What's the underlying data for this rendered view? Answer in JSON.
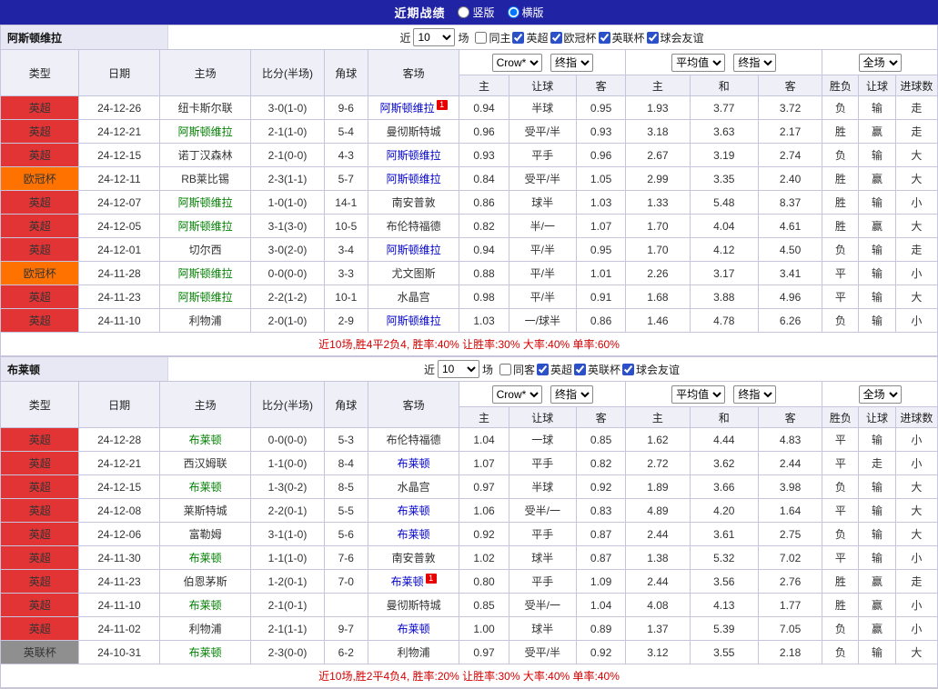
{
  "topbar": {
    "title": "近期战绩",
    "layout_options": [
      {
        "label": "竖版",
        "selected": false
      },
      {
        "label": "横版",
        "selected": true
      }
    ]
  },
  "columns": {
    "main": [
      "类型",
      "日期",
      "主场",
      "比分(半场)",
      "角球",
      "客场"
    ],
    "sub": [
      "主",
      "让球",
      "客",
      "主",
      "和",
      "客",
      "胜负",
      "让球",
      "进球数"
    ]
  },
  "colors": {
    "topbar_bg": "#2123a5",
    "league_red": "#e23434",
    "league_orange": "#ff7200",
    "league_gray": "#8f8f8f",
    "text_red": "#d40000",
    "text_blue": "#0000cc",
    "text_green": "#008000",
    "header_bg": "#efeff8",
    "team_home_green": "#008000",
    "team_away_blue": "#0000cc"
  },
  "sections": [
    {
      "team": "阿斯顿维拉",
      "filter": {
        "prefix": "近",
        "count": "10",
        "suffix": "场",
        "checkboxes": [
          {
            "label": "同主",
            "checked": false
          },
          {
            "label": "英超",
            "checked": true
          },
          {
            "label": "欧冠杯",
            "checked": true
          },
          {
            "label": "英联杯",
            "checked": true
          },
          {
            "label": "球会友谊",
            "checked": true
          }
        ]
      },
      "dropdowns": {
        "bookmaker": "Crow*",
        "ah_stage": "终指",
        "eu_source": "平均值",
        "eu_stage": "终指",
        "scope": "全场"
      },
      "rows": [
        {
          "lg": "英超",
          "lgc": "red",
          "date": "24-12-26",
          "home": "纽卡斯尔联",
          "homeHl": "",
          "homeCard": "",
          "score": "3-0(1-0)",
          "corner": "9-6",
          "away": "阿斯顿维拉",
          "awayHl": "blue",
          "awayCard": "1",
          "ah": [
            "0.94",
            "半球",
            "0.95"
          ],
          "eu": [
            "1.93",
            "3.77",
            "3.72"
          ],
          "res": [
            [
              "负",
              "blue"
            ],
            [
              "输",
              "blue"
            ],
            [
              "走",
              "green"
            ]
          ]
        },
        {
          "lg": "英超",
          "lgc": "red",
          "date": "24-12-21",
          "home": "阿斯顿维拉",
          "homeHl": "green",
          "homeCard": "",
          "score": "2-1(1-0)",
          "corner": "5-4",
          "away": "曼彻斯特城",
          "awayHl": "",
          "awayCard": "",
          "ah": [
            "0.96",
            "受平/半",
            "0.93"
          ],
          "eu": [
            "3.18",
            "3.63",
            "2.17"
          ],
          "res": [
            [
              "胜",
              "red"
            ],
            [
              "赢",
              "red"
            ],
            [
              "走",
              "green"
            ]
          ]
        },
        {
          "lg": "英超",
          "lgc": "red",
          "date": "24-12-15",
          "home": "诺丁汉森林",
          "homeHl": "",
          "homeCard": "",
          "score": "2-1(0-0)",
          "corner": "4-3",
          "away": "阿斯顿维拉",
          "awayHl": "blue",
          "awayCard": "",
          "ah": [
            "0.93",
            "平手",
            "0.96"
          ],
          "eu": [
            "2.67",
            "3.19",
            "2.74"
          ],
          "res": [
            [
              "负",
              "blue"
            ],
            [
              "输",
              "blue"
            ],
            [
              "大",
              "red"
            ]
          ]
        },
        {
          "lg": "欧冠杯",
          "lgc": "orange",
          "date": "24-12-11",
          "home": "RB莱比锡",
          "homeHl": "",
          "homeCard": "",
          "score": "2-3(1-1)",
          "corner": "5-7",
          "away": "阿斯顿维拉",
          "awayHl": "blue",
          "awayCard": "",
          "ah": [
            "0.84",
            "受平/半",
            "1.05"
          ],
          "eu": [
            "2.99",
            "3.35",
            "2.40"
          ],
          "res": [
            [
              "胜",
              "red"
            ],
            [
              "赢",
              "red"
            ],
            [
              "大",
              "red"
            ]
          ]
        },
        {
          "lg": "英超",
          "lgc": "red",
          "date": "24-12-07",
          "home": "阿斯顿维拉",
          "homeHl": "green",
          "homeCard": "",
          "score": "1-0(1-0)",
          "corner": "14-1",
          "away": "南安普敦",
          "awayHl": "",
          "awayCard": "",
          "ah": [
            "0.86",
            "球半",
            "1.03"
          ],
          "eu": [
            "1.33",
            "5.48",
            "8.37"
          ],
          "res": [
            [
              "胜",
              "red"
            ],
            [
              "输",
              "blue"
            ],
            [
              "小",
              "blue"
            ]
          ]
        },
        {
          "lg": "英超",
          "lgc": "red",
          "date": "24-12-05",
          "home": "阿斯顿维拉",
          "homeHl": "green",
          "homeCard": "",
          "score": "3-1(3-0)",
          "corner": "10-5",
          "away": "布伦特福德",
          "awayHl": "",
          "awayCard": "",
          "ah": [
            "0.82",
            "半/一",
            "1.07"
          ],
          "eu": [
            "1.70",
            "4.04",
            "4.61"
          ],
          "res": [
            [
              "胜",
              "red"
            ],
            [
              "赢",
              "red"
            ],
            [
              "大",
              "red"
            ]
          ]
        },
        {
          "lg": "英超",
          "lgc": "red",
          "date": "24-12-01",
          "home": "切尔西",
          "homeHl": "",
          "homeCard": "",
          "score": "3-0(2-0)",
          "corner": "3-4",
          "away": "阿斯顿维拉",
          "awayHl": "blue",
          "awayCard": "",
          "ah": [
            "0.94",
            "平/半",
            "0.95"
          ],
          "eu": [
            "1.70",
            "4.12",
            "4.50"
          ],
          "res": [
            [
              "负",
              "blue"
            ],
            [
              "输",
              "blue"
            ],
            [
              "走",
              "green"
            ]
          ]
        },
        {
          "lg": "欧冠杯",
          "lgc": "orange",
          "date": "24-11-28",
          "home": "阿斯顿维拉",
          "homeHl": "green",
          "homeCard": "",
          "score": "0-0(0-0)",
          "corner": "3-3",
          "away": "尤文图斯",
          "awayHl": "",
          "awayCard": "",
          "ah": [
            "0.88",
            "平/半",
            "1.01"
          ],
          "eu": [
            "2.26",
            "3.17",
            "3.41"
          ],
          "res": [
            [
              "平",
              "green"
            ],
            [
              "输",
              "blue"
            ],
            [
              "小",
              "blue"
            ]
          ]
        },
        {
          "lg": "英超",
          "lgc": "red",
          "date": "24-11-23",
          "home": "阿斯顿维拉",
          "homeHl": "green",
          "homeCard": "",
          "score": "2-2(1-2)",
          "corner": "10-1",
          "away": "水晶宫",
          "awayHl": "",
          "awayCard": "",
          "ah": [
            "0.98",
            "平/半",
            "0.91"
          ],
          "eu": [
            "1.68",
            "3.88",
            "4.96"
          ],
          "res": [
            [
              "平",
              "green"
            ],
            [
              "输",
              "blue"
            ],
            [
              "大",
              "red"
            ]
          ]
        },
        {
          "lg": "英超",
          "lgc": "red",
          "date": "24-11-10",
          "home": "利物浦",
          "homeHl": "",
          "homeCard": "",
          "score": "2-0(1-0)",
          "corner": "2-9",
          "away": "阿斯顿维拉",
          "awayHl": "blue",
          "awayCard": "",
          "ah": [
            "1.03",
            "一/球半",
            "0.86"
          ],
          "eu": [
            "1.46",
            "4.78",
            "6.26"
          ],
          "res": [
            [
              "负",
              "blue"
            ],
            [
              "输",
              "blue"
            ],
            [
              "小",
              "blue"
            ]
          ]
        }
      ],
      "summary": "近10场,胜4平2负4, 胜率:40% 让胜率:30% 大率:40% 单率:60%"
    },
    {
      "team": "布莱顿",
      "filter": {
        "prefix": "近",
        "count": "10",
        "suffix": "场",
        "checkboxes": [
          {
            "label": "同客",
            "checked": false
          },
          {
            "label": "英超",
            "checked": true
          },
          {
            "label": "英联杯",
            "checked": true
          },
          {
            "label": "球会友谊",
            "checked": true
          }
        ]
      },
      "dropdowns": {
        "bookmaker": "Crow*",
        "ah_stage": "终指",
        "eu_source": "平均值",
        "eu_stage": "终指",
        "scope": "全场"
      },
      "rows": [
        {
          "lg": "英超",
          "lgc": "red",
          "date": "24-12-28",
          "home": "布莱顿",
          "homeHl": "green",
          "homeCard": "",
          "score": "0-0(0-0)",
          "corner": "5-3",
          "away": "布伦特福德",
          "awayHl": "",
          "awayCard": "",
          "ah": [
            "1.04",
            "一球",
            "0.85"
          ],
          "eu": [
            "1.62",
            "4.44",
            "4.83"
          ],
          "res": [
            [
              "平",
              "green"
            ],
            [
              "输",
              "blue"
            ],
            [
              "小",
              "blue"
            ]
          ]
        },
        {
          "lg": "英超",
          "lgc": "red",
          "date": "24-12-21",
          "home": "西汉姆联",
          "homeHl": "",
          "homeCard": "",
          "score": "1-1(0-0)",
          "corner": "8-4",
          "away": "布莱顿",
          "awayHl": "blue",
          "awayCard": "",
          "ah": [
            "1.07",
            "平手",
            "0.82"
          ],
          "eu": [
            "2.72",
            "3.62",
            "2.44"
          ],
          "res": [
            [
              "平",
              "green"
            ],
            [
              "走",
              "green"
            ],
            [
              "小",
              "blue"
            ]
          ]
        },
        {
          "lg": "英超",
          "lgc": "red",
          "date": "24-12-15",
          "home": "布莱顿",
          "homeHl": "green",
          "homeCard": "",
          "score": "1-3(0-2)",
          "corner": "8-5",
          "away": "水晶宫",
          "awayHl": "",
          "awayCard": "",
          "ah": [
            "0.97",
            "半球",
            "0.92"
          ],
          "eu": [
            "1.89",
            "3.66",
            "3.98"
          ],
          "res": [
            [
              "负",
              "blue"
            ],
            [
              "输",
              "blue"
            ],
            [
              "大",
              "red"
            ]
          ]
        },
        {
          "lg": "英超",
          "lgc": "red",
          "date": "24-12-08",
          "home": "莱斯特城",
          "homeHl": "",
          "homeCard": "",
          "score": "2-2(0-1)",
          "corner": "5-5",
          "away": "布莱顿",
          "awayHl": "blue",
          "awayCard": "",
          "ah": [
            "1.06",
            "受半/一",
            "0.83"
          ],
          "eu": [
            "4.89",
            "4.20",
            "1.64"
          ],
          "res": [
            [
              "平",
              "green"
            ],
            [
              "输",
              "blue"
            ],
            [
              "大",
              "red"
            ]
          ]
        },
        {
          "lg": "英超",
          "lgc": "red",
          "date": "24-12-06",
          "home": "富勒姆",
          "homeHl": "",
          "homeCard": "",
          "score": "3-1(1-0)",
          "corner": "5-6",
          "away": "布莱顿",
          "awayHl": "blue",
          "awayCard": "",
          "ah": [
            "0.92",
            "平手",
            "0.87"
          ],
          "eu": [
            "2.44",
            "3.61",
            "2.75"
          ],
          "res": [
            [
              "负",
              "blue"
            ],
            [
              "输",
              "blue"
            ],
            [
              "大",
              "red"
            ]
          ]
        },
        {
          "lg": "英超",
          "lgc": "red",
          "date": "24-11-30",
          "home": "布莱顿",
          "homeHl": "green",
          "homeCard": "",
          "score": "1-1(1-0)",
          "corner": "7-6",
          "away": "南安普敦",
          "awayHl": "",
          "awayCard": "",
          "ah": [
            "1.02",
            "球半",
            "0.87"
          ],
          "eu": [
            "1.38",
            "5.32",
            "7.02"
          ],
          "res": [
            [
              "平",
              "green"
            ],
            [
              "输",
              "blue"
            ],
            [
              "小",
              "blue"
            ]
          ]
        },
        {
          "lg": "英超",
          "lgc": "red",
          "date": "24-11-23",
          "home": "伯恩茅斯",
          "homeHl": "",
          "homeCard": "",
          "score": "1-2(0-1)",
          "corner": "7-0",
          "away": "布莱顿",
          "awayHl": "blue",
          "awayCard": "1",
          "ah": [
            "0.80",
            "平手",
            "1.09"
          ],
          "eu": [
            "2.44",
            "3.56",
            "2.76"
          ],
          "res": [
            [
              "胜",
              "red"
            ],
            [
              "赢",
              "red"
            ],
            [
              "走",
              "green"
            ]
          ]
        },
        {
          "lg": "英超",
          "lgc": "red",
          "date": "24-11-10",
          "home": "布莱顿",
          "homeHl": "green",
          "homeCard": "",
          "score": "2-1(0-1)",
          "corner": "",
          "away": "曼彻斯特城",
          "awayHl": "",
          "awayCard": "",
          "ah": [
            "0.85",
            "受半/一",
            "1.04"
          ],
          "eu": [
            "4.08",
            "4.13",
            "1.77"
          ],
          "res": [
            [
              "胜",
              "red"
            ],
            [
              "赢",
              "red"
            ],
            [
              "小",
              "blue"
            ]
          ]
        },
        {
          "lg": "英超",
          "lgc": "red",
          "date": "24-11-02",
          "home": "利物浦",
          "homeHl": "",
          "homeCard": "",
          "score": "2-1(1-1)",
          "corner": "9-7",
          "away": "布莱顿",
          "awayHl": "blue",
          "awayCard": "",
          "ah": [
            "1.00",
            "球半",
            "0.89"
          ],
          "eu": [
            "1.37",
            "5.39",
            "7.05"
          ],
          "res": [
            [
              "负",
              "blue"
            ],
            [
              "赢",
              "red"
            ],
            [
              "小",
              "blue"
            ]
          ]
        },
        {
          "lg": "英联杯",
          "lgc": "gray",
          "date": "24-10-31",
          "home": "布莱顿",
          "homeHl": "green",
          "homeCard": "",
          "score": "2-3(0-0)",
          "corner": "6-2",
          "away": "利物浦",
          "awayHl": "",
          "awayCard": "",
          "ah": [
            "0.97",
            "受平/半",
            "0.92"
          ],
          "eu": [
            "3.12",
            "3.55",
            "2.18"
          ],
          "res": [
            [
              "负",
              "blue"
            ],
            [
              "输",
              "blue"
            ],
            [
              "大",
              "red"
            ]
          ]
        }
      ],
      "summary": "近10场,胜2平4负4, 胜率:20% 让胜率:30% 大率:40% 单率:40%"
    }
  ]
}
